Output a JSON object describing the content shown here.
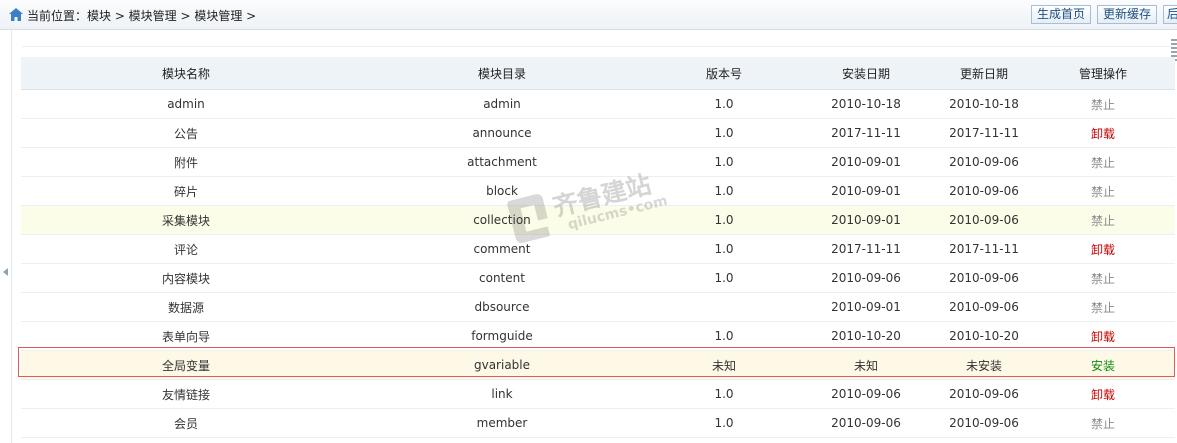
{
  "breadcrumb": {
    "text": "当前位置：模块 > 模块管理 > 模块管理 >"
  },
  "toolbar": {
    "buttons": [
      "生成首页",
      "更新缓存",
      "后"
    ]
  },
  "table": {
    "headers": [
      "模块名称",
      "模块目录",
      "版本号",
      "安装日期",
      "更新日期",
      "管理操作"
    ],
    "rows": [
      {
        "name": "admin",
        "dir": "admin",
        "version": "1.0",
        "install": "2010-10-18",
        "update": "2010-10-18",
        "action": "禁止",
        "action_type": "disabled"
      },
      {
        "name": "公告",
        "dir": "announce",
        "version": "1.0",
        "install": "2017-11-11",
        "update": "2017-11-11",
        "action": "卸载",
        "action_type": "uninstall"
      },
      {
        "name": "附件",
        "dir": "attachment",
        "version": "1.0",
        "install": "2010-09-01",
        "update": "2010-09-06",
        "action": "禁止",
        "action_type": "disabled"
      },
      {
        "name": "碎片",
        "dir": "block",
        "version": "1.0",
        "install": "2010-09-01",
        "update": "2010-09-06",
        "action": "禁止",
        "action_type": "disabled"
      },
      {
        "name": "采集模块",
        "dir": "collection",
        "version": "1.0",
        "install": "2010-09-01",
        "update": "2010-09-06",
        "action": "禁止",
        "action_type": "disabled",
        "state": "hover"
      },
      {
        "name": "评论",
        "dir": "comment",
        "version": "1.0",
        "install": "2017-11-11",
        "update": "2017-11-11",
        "action": "卸载",
        "action_type": "uninstall"
      },
      {
        "name": "内容模块",
        "dir": "content",
        "version": "1.0",
        "install": "2010-09-06",
        "update": "2010-09-06",
        "action": "禁止",
        "action_type": "disabled"
      },
      {
        "name": "数据源",
        "dir": "dbsource",
        "version": "",
        "install": "2010-09-01",
        "update": "2010-09-06",
        "action": "禁止",
        "action_type": "disabled"
      },
      {
        "name": "表单向导",
        "dir": "formguide",
        "version": "1.0",
        "install": "2010-10-20",
        "update": "2010-10-20",
        "action": "卸载",
        "action_type": "uninstall"
      },
      {
        "name": "全局变量",
        "dir": "gvariable",
        "version": "未知",
        "install": "未知",
        "update": "未安装",
        "action": "安装",
        "action_type": "install",
        "state": "selected"
      },
      {
        "name": "友情链接",
        "dir": "link",
        "version": "1.0",
        "install": "2010-09-06",
        "update": "2010-09-06",
        "action": "卸载",
        "action_type": "uninstall"
      },
      {
        "name": "会员",
        "dir": "member",
        "version": "1.0",
        "install": "2010-09-06",
        "update": "2010-09-06",
        "action": "禁止",
        "action_type": "disabled"
      }
    ]
  },
  "watermark": {
    "text": "齐鲁建站",
    "sub": "qilucms•com"
  },
  "colors": {
    "uninstall": "#c40000",
    "install": "#118a11",
    "disabled": "#8a8a8a",
    "selected_border": "#e05a5a"
  }
}
